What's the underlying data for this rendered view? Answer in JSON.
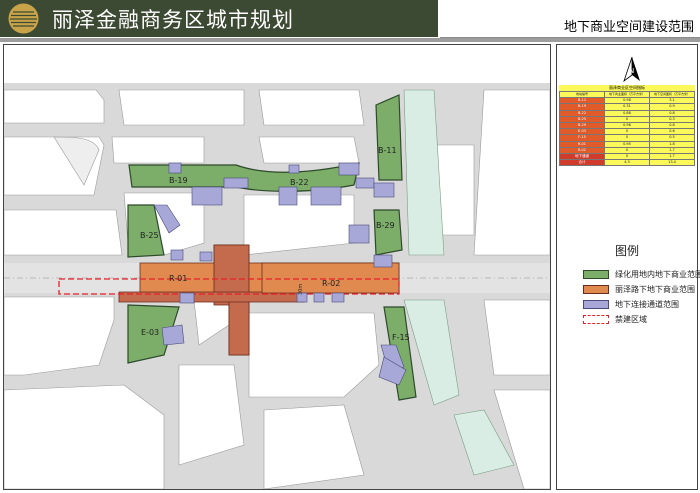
{
  "header": {
    "title": "丽泽金融商务区城市规划",
    "subtitle": "地下商业空间建设范围"
  },
  "map": {
    "parcels": [
      {
        "id": "B-11"
      },
      {
        "id": "B-19"
      },
      {
        "id": "B-22"
      },
      {
        "id": "B-25"
      },
      {
        "id": "B-29"
      },
      {
        "id": "R-01"
      },
      {
        "id": "R-02"
      },
      {
        "id": "E-03"
      },
      {
        "id": "F-15"
      }
    ],
    "road_width_label": "30m"
  },
  "summary_table": {
    "title": "丽泽商业区空间指标",
    "columns": [
      "地块编号",
      "地下商业面积（万平方米）",
      "地下空间面积（万平方米）"
    ],
    "rows": [
      {
        "code": "B-11",
        "v1": "0.98",
        "v2": "3.1",
        "color": "#e05a2a"
      },
      {
        "code": "B-19",
        "v1": "0.31",
        "v2": "0.9",
        "color": "#e05a2a"
      },
      {
        "code": "B-22",
        "v1": "0.88",
        "v2": "0.8",
        "color": "#e05a2a"
      },
      {
        "code": "B-25",
        "v1": "0",
        "v2": "0.3",
        "color": "#e05a2a"
      },
      {
        "code": "B-29",
        "v1": "0.96",
        "v2": "0.8",
        "color": "#e05a2a"
      },
      {
        "code": "E-03",
        "v1": "0",
        "v2": "0.6",
        "color": "#e05a2a"
      },
      {
        "code": "F-15",
        "v1": "0",
        "v2": "0.5",
        "color": "#e05a2a"
      },
      {
        "code": "R-01",
        "v1": "0.95",
        "v2": "1.8",
        "color": "#e05a2a"
      },
      {
        "code": "R-02",
        "v1": "0",
        "v2": "1.7",
        "color": "#e05a2a"
      },
      {
        "code": "地下通道",
        "v1": "0",
        "v2": "1.7",
        "color": "#d13b2b"
      },
      {
        "code": "合计",
        "v1": "4.3",
        "v2": "13.4",
        "color": "#d13b2b"
      }
    ]
  },
  "legend": {
    "title": "图例",
    "items": [
      {
        "label": "绿化用地内地下商业范围",
        "color": "#7cae6a"
      },
      {
        "label": "丽泽路下地下商业范围",
        "color": "#e08a4f"
      },
      {
        "label": "地下连接通道范围",
        "color": "#a7a8d8"
      },
      {
        "label": "禁建区域",
        "color": "#e8212a"
      }
    ]
  },
  "north_arrow": {
    "label": "N"
  }
}
